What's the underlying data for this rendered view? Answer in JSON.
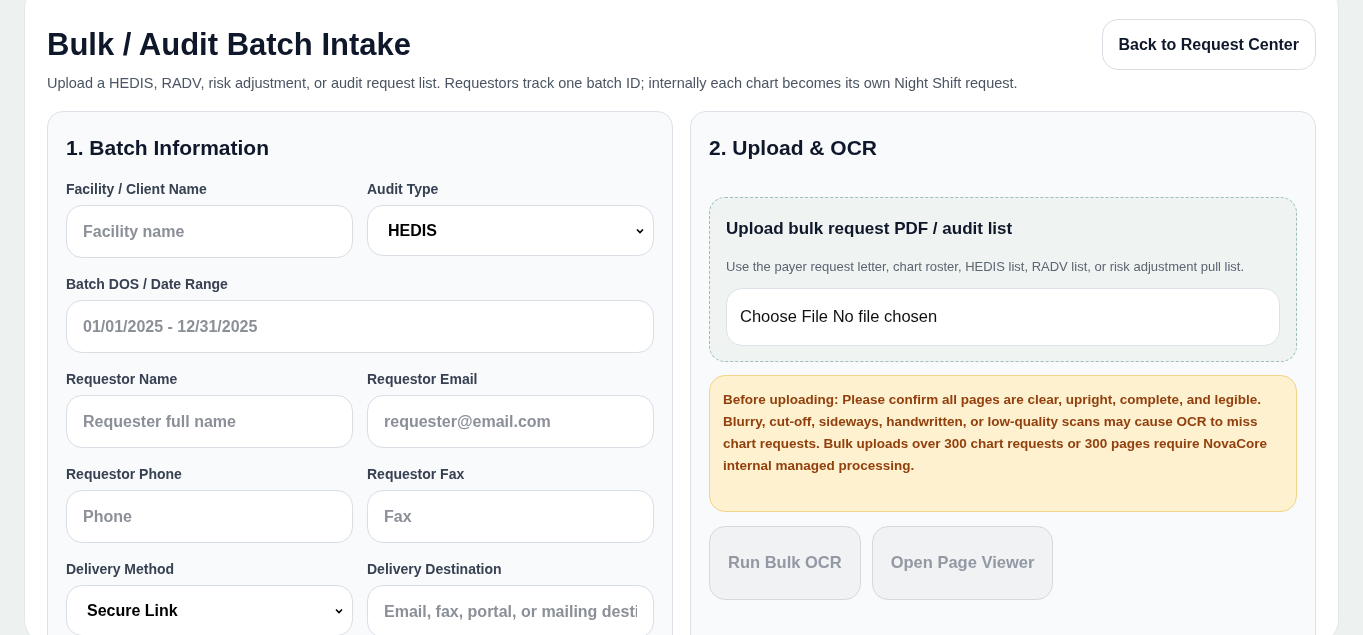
{
  "header": {
    "title": "Bulk / Audit Batch Intake",
    "subtitle": "Upload a HEDIS, RADV, risk adjustment, or audit request list. Requestors track one batch ID; internally each chart becomes its own Night Shift request.",
    "back_button": "Back to Request Center"
  },
  "batch_panel": {
    "title": "1. Batch Information",
    "fields": [
      {
        "kind": "input",
        "label": "Facility / Client Name",
        "placeholder": "Facility name",
        "wide": false
      },
      {
        "kind": "select",
        "label": "Audit Type",
        "value": "HEDIS",
        "wide": false
      },
      {
        "kind": "input",
        "label": "Batch DOS / Date Range",
        "placeholder": "01/01/2025 - 12/31/2025",
        "wide": true
      },
      {
        "kind": "input",
        "label": "Requestor Name",
        "placeholder": "Requester full name",
        "wide": false
      },
      {
        "kind": "input",
        "label": "Requestor Email",
        "placeholder": "requester@email.com",
        "wide": false
      },
      {
        "kind": "input",
        "label": "Requestor Phone",
        "placeholder": "Phone",
        "wide": false
      },
      {
        "kind": "input",
        "label": "Requestor Fax",
        "placeholder": "Fax",
        "wide": false
      },
      {
        "kind": "select",
        "label": "Delivery Method",
        "value": "Secure Link",
        "wide": false
      },
      {
        "kind": "input",
        "label": "Delivery Destination",
        "placeholder": "Email, fax, portal, or mailing desti",
        "wide": false
      }
    ]
  },
  "upload_panel": {
    "title": "2. Upload & OCR",
    "dropzone": {
      "title": "Upload bulk request PDF / audit list",
      "hint": "Use the payer request letter, chart roster, HEDIS list, RADV list, or risk adjustment pull list.",
      "file_input": "Choose File No file chosen"
    },
    "warning": "Before uploading: Please confirm all pages are clear, upright, complete, and legible. Blurry, cut-off, sideways, handwritten, or low-quality scans may cause OCR to miss chart requests. Bulk uploads over 300 chart requests or 300 pages require NovaCore internal managed processing.",
    "buttons": [
      {
        "label": "Run Bulk OCR",
        "disabled": true
      },
      {
        "label": "Open Page Viewer",
        "disabled": true
      }
    ]
  }
}
